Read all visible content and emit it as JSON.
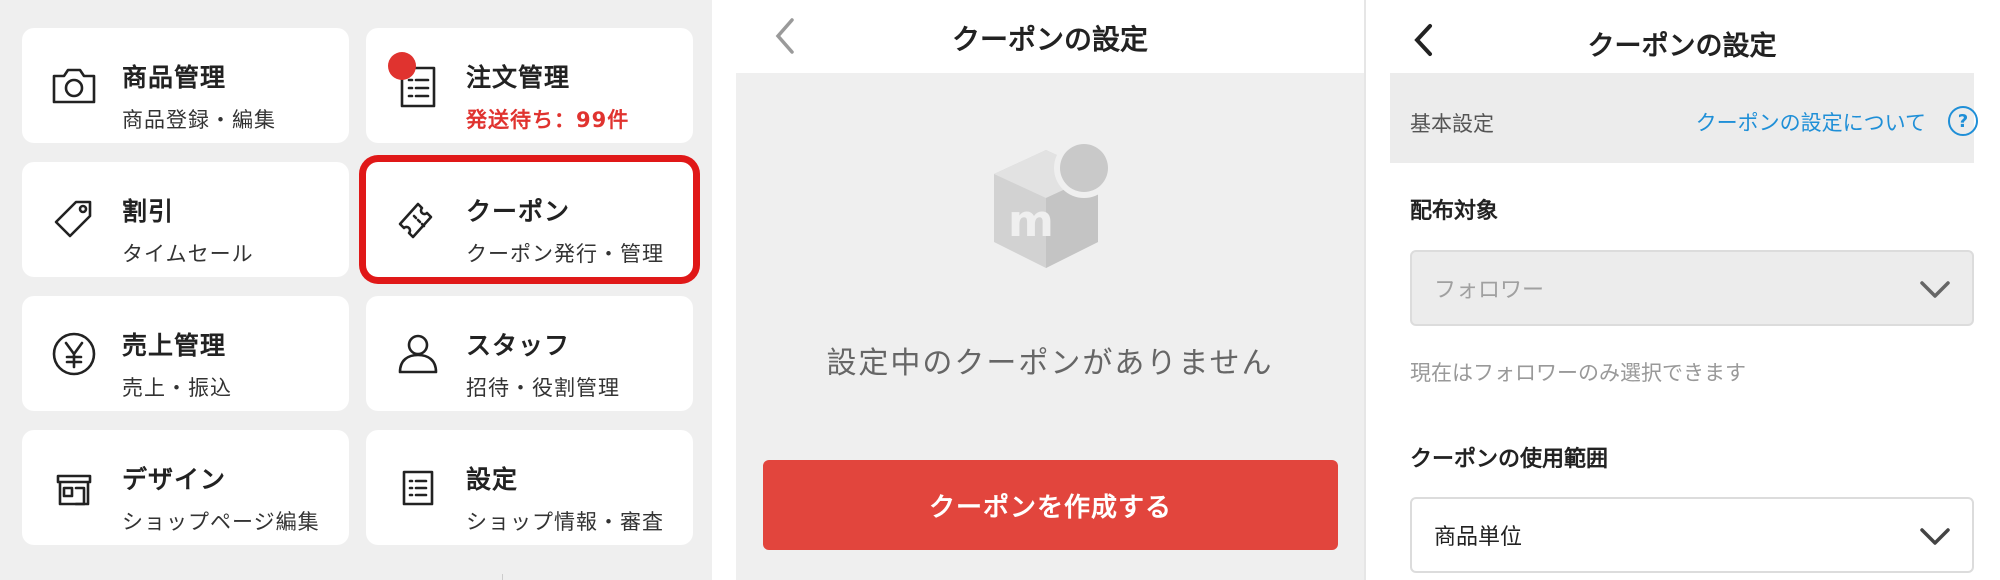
{
  "menu": {
    "items": [
      {
        "title": "商品管理",
        "subtitle": "商品登録・編集",
        "icon": "camera-icon"
      },
      {
        "title": "注文管理",
        "subtitle": "発送待ち：99件",
        "icon": "order-list-icon"
      },
      {
        "title": "割引",
        "subtitle": "タイムセール",
        "icon": "tag-icon"
      },
      {
        "title": "クーポン",
        "subtitle": "クーポン発行・管理",
        "icon": "ticket-icon"
      },
      {
        "title": "売上管理",
        "subtitle": "売上・振込",
        "icon": "yen-icon"
      },
      {
        "title": "スタッフ",
        "subtitle": "招待・役割管理",
        "icon": "person-icon"
      },
      {
        "title": "デザイン",
        "subtitle": "ショップページ編集",
        "icon": "storefront-icon"
      },
      {
        "title": "設定",
        "subtitle": "ショップ情報・審査",
        "icon": "settings-list-icon"
      }
    ],
    "highlight_color": "#e01818",
    "alert_color": "#e0332f"
  },
  "coupon_empty": {
    "title": "クーポンの設定",
    "empty_message": "設定中のクーポンがありません",
    "create_button": "クーポンを作成する",
    "button_color": "#e2453d"
  },
  "coupon_settings": {
    "title": "クーポンの設定",
    "section": "基本設定",
    "help_link": "クーポンの設定について",
    "help_icon_label": "?",
    "target_label": "配布対象",
    "target_value": "フォロワー",
    "target_note": "現在はフォロワーのみ選択できます",
    "scope_label": "クーポンの使用範囲",
    "scope_value": "商品単位",
    "link_color": "#1f8fd7"
  }
}
